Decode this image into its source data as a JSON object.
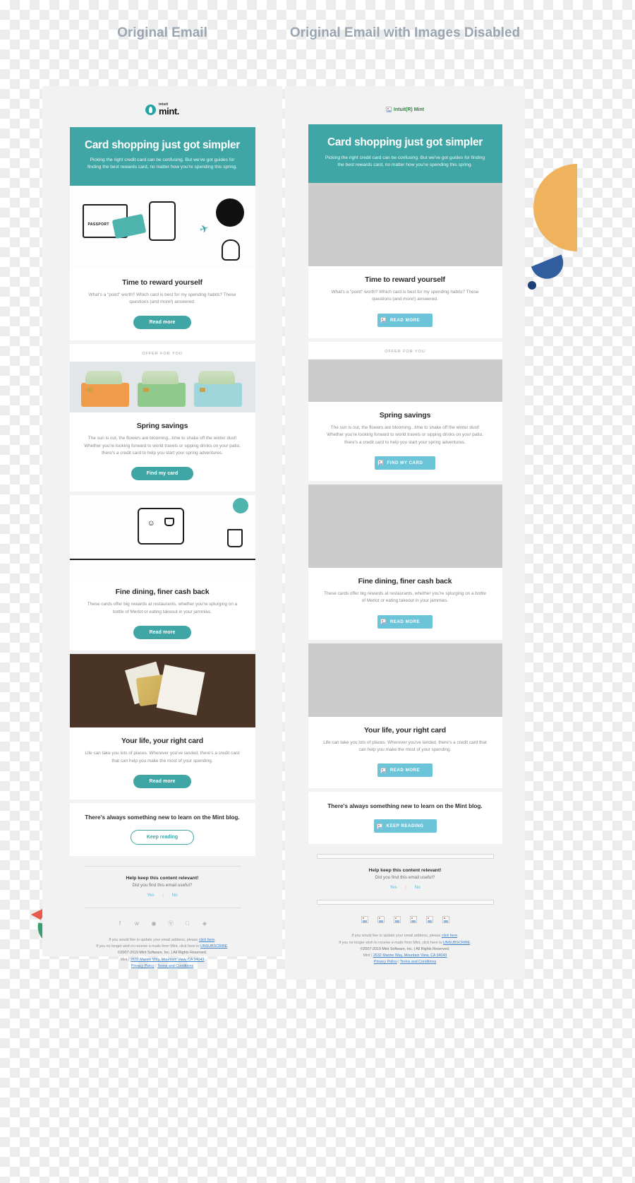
{
  "comparison": {
    "left_title": "Original Email",
    "right_title": "Original Email with Images Disabled"
  },
  "brand": {
    "intuit": "intuit",
    "mint": "mint.",
    "logo_alt": "Intuit(R) Mint",
    "accent": "#3fa5a5",
    "disabled_btn_color": "#6bc4d8",
    "placeholder_color": "#cccccc",
    "alt_text_color": "#2c8a3c"
  },
  "hero": {
    "title": "Card shopping just got simpler",
    "subtitle": "Picking the right credit card can be confusing. But we've got guides for finding the best rewards card, no matter how you're spending this spring."
  },
  "sections": [
    {
      "eyebrow": "",
      "title": "Time to reward yourself",
      "body": "What's a \"point\" worth? Which card is best for my spending habits? These questions (and more!) answered.",
      "button": "Read more",
      "button_disabled": "READ MORE"
    },
    {
      "eyebrow": "OFFER FOR YOU",
      "title": "Spring savings",
      "body": "The sun is out, the flowers are blooming...time to shake off the winter dust! Whether you're looking forward to world travels or sipping drinks on your patio, there's a credit card to help you start your spring adventures.",
      "button": "Find my card",
      "button_disabled": "FIND MY CARD"
    },
    {
      "eyebrow": "",
      "title": "Fine dining, finer cash back",
      "body": "These cards offer big rewards at restaurants, whether you're splurging on a bottle of Merlot or eating takeout in your jammies.",
      "button": "Read more",
      "button_disabled": "READ MORE"
    },
    {
      "eyebrow": "",
      "title": "Your life, your right card",
      "body": "Life can take you lots of places. Wherever you've landed, there's a credit card that can help you make the most of your spending.",
      "button": "Read more",
      "button_disabled": "READ MORE"
    }
  ],
  "blog": {
    "text": "There's always something new to learn on the Mint blog.",
    "button": "Keep reading",
    "button_disabled": "KEEP READING"
  },
  "feedback": {
    "title": "Help keep this content relevant!",
    "subtitle": "Did you find this email useful?",
    "yes": "Yes",
    "separator": "|",
    "no": "No"
  },
  "social": {
    "icons": [
      "facebook-icon",
      "twitter-icon",
      "instagram-icon",
      "pinterest-icon",
      "apple-icon",
      "android-icon"
    ],
    "glyphs": [
      "f",
      "t",
      "◎",
      "ⓟ",
      "●",
      "▲"
    ]
  },
  "footer": {
    "line1_pre": "If you would like to update your email address, please ",
    "line1_link": "click here",
    "line1_post": ".",
    "line2_pre": "If you no longer wish to receive e-mails from Mint, click here to ",
    "line2_link": "UNSUBSCRIBE",
    "line2_post": ".",
    "copyright": "©2007-2019 Mint Software, Inc. | All Rights Reserved.",
    "address_pre": "Mint | ",
    "address_link": "2632 Marine Way, Mountain View, CA 94043",
    "privacy": "Privacy Policy",
    "legal_sep": " | ",
    "terms": "Terms and Conditions"
  }
}
